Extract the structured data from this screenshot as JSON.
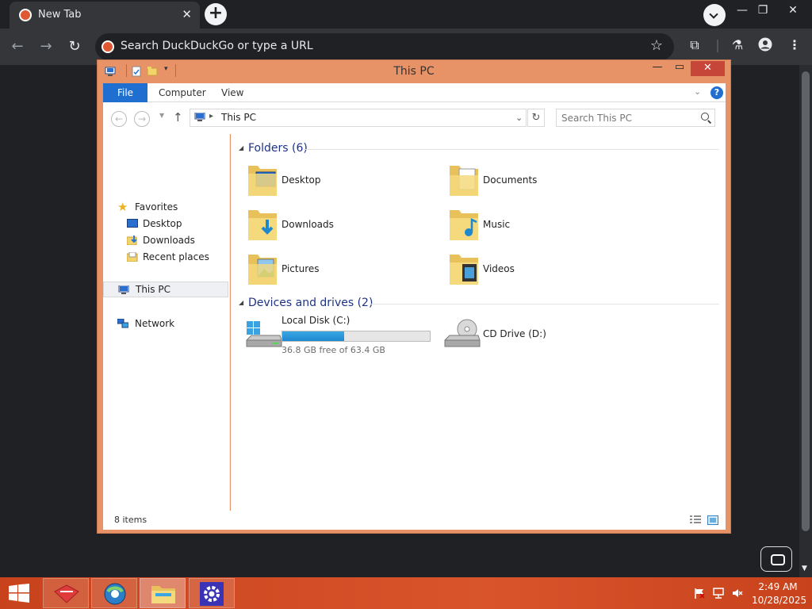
{
  "browser": {
    "tab_title": "New Tab",
    "tab_close": "✕",
    "new_tab": "+",
    "omnibox_placeholder": "Search DuckDuckGo or type a URL",
    "win_minimize": "—",
    "win_restore": "❐",
    "win_close": "✕"
  },
  "explorer": {
    "title": "This PC",
    "ribbon_tabs": [
      "File",
      "Computer",
      "View"
    ],
    "help": "?",
    "address_path": "This PC",
    "search_placeholder": "Search This PC",
    "nav": {
      "favorites": "Favorites",
      "desktop": "Desktop",
      "downloads": "Downloads",
      "recent_places": "Recent places",
      "this_pc": "This PC",
      "network": "Network"
    },
    "folders_group": "Folders (6)",
    "folders": [
      "Desktop",
      "Documents",
      "Downloads",
      "Music",
      "Pictures",
      "Videos"
    ],
    "devices_group": "Devices and drives (2)",
    "drives": {
      "c": {
        "name": "Local Disk (C:)",
        "free_text": "36.8 GB free of 63.4 GB",
        "used_fraction": 0.42
      },
      "d": {
        "name": "CD Drive (D:)"
      }
    },
    "status": "8 items"
  },
  "taskbar": {
    "time": "2:49 AM",
    "date": "10/28/2025"
  },
  "colors": {
    "window_frame": "#e79267",
    "accent_blue": "#1e6fd0",
    "taskbar": "#d9542b",
    "close_red": "#c7463a"
  }
}
